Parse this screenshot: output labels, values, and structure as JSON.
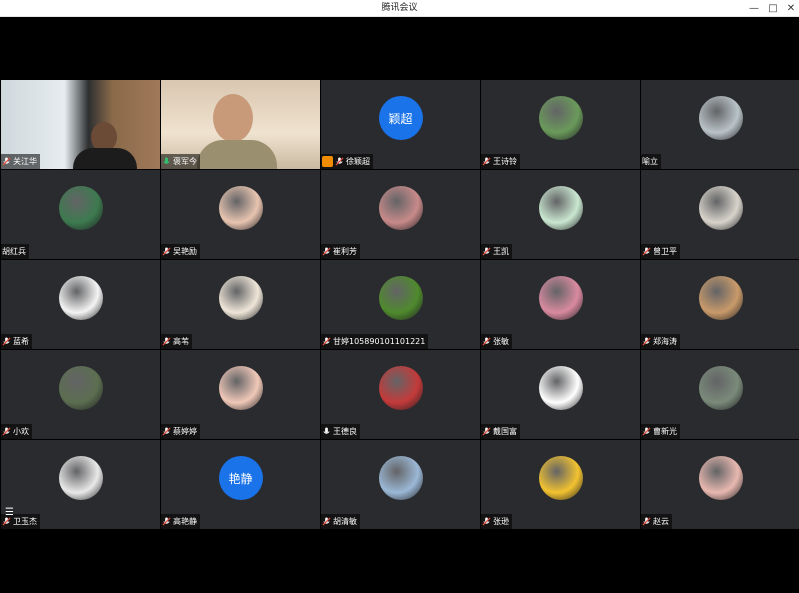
{
  "window": {
    "title": "腾讯会议"
  },
  "participants": [
    {
      "name": "关江华",
      "kind": "video1",
      "mic": "off"
    },
    {
      "name": "褒军今",
      "kind": "video2",
      "mic": "on",
      "speaking": true
    },
    {
      "name": "徐颖超",
      "kind": "text",
      "avatar_text": "颖超",
      "mic": "off",
      "host": true
    },
    {
      "name": "王诗铃",
      "kind": "image",
      "color": "#6a9a5b",
      "mic": "off"
    },
    {
      "name": "喻立",
      "kind": "image",
      "color": "#b9c3c8",
      "mic": "none"
    },
    {
      "name": "胡红兵",
      "kind": "image",
      "color": "#3d7a4f",
      "mic": "none"
    },
    {
      "name": "吴艳励",
      "kind": "image",
      "color": "#e8c4b0",
      "mic": "off"
    },
    {
      "name": "崔利芳",
      "kind": "image",
      "color": "#c88a8a",
      "mic": "off"
    },
    {
      "name": "王凯",
      "kind": "image",
      "color": "#c9e7d0",
      "mic": "off"
    },
    {
      "name": "曾卫平",
      "kind": "image",
      "color": "#d8d4cc",
      "mic": "off"
    },
    {
      "name": "蓝希",
      "kind": "image",
      "color": "#f4f4f4",
      "mic": "off"
    },
    {
      "name": "高苇",
      "kind": "image",
      "color": "#efe6d8",
      "mic": "off"
    },
    {
      "name": "甘婷105890101101221",
      "kind": "image",
      "color": "#4f8a2d",
      "mic": "off"
    },
    {
      "name": "张敏",
      "kind": "image",
      "color": "#d98aa0",
      "mic": "off"
    },
    {
      "name": "郑海涛",
      "kind": "image",
      "color": "#c99a6a",
      "mic": "off"
    },
    {
      "name": "小欢",
      "kind": "image",
      "color": "#5c6e50",
      "mic": "off"
    },
    {
      "name": "蔡婷婷",
      "kind": "image",
      "color": "#f0c8b8",
      "mic": "off"
    },
    {
      "name": "王德良",
      "kind": "image",
      "color": "#c43a3a",
      "mic": "mic"
    },
    {
      "name": "戴国富",
      "kind": "image",
      "color": "#ffffff",
      "mic": "off"
    },
    {
      "name": "曹新光",
      "kind": "image",
      "color": "#7a8a7a",
      "mic": "off"
    },
    {
      "name": "卫玉杰",
      "kind": "image",
      "color": "#e9e9e9",
      "mic": "off"
    },
    {
      "name": "高艳静",
      "kind": "text",
      "avatar_text": "艳静",
      "mic": "off"
    },
    {
      "name": "胡清敏",
      "kind": "image",
      "color": "#9bb8d6",
      "mic": "off"
    },
    {
      "name": "张逊",
      "kind": "image",
      "color": "#f2c230",
      "mic": "off"
    },
    {
      "name": "赵云",
      "kind": "image",
      "color": "#e8b8b0",
      "mic": "off"
    }
  ],
  "colors": {
    "accent": "#1a73e8",
    "speaking": "#2ecc71",
    "tile_bg": "#2a2b2e",
    "host_badge": "#f08c00"
  }
}
